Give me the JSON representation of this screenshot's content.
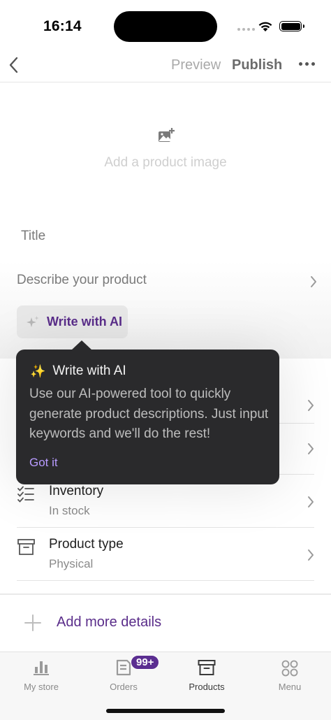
{
  "status_bar": {
    "time": "16:14"
  },
  "nav": {
    "preview_label": "Preview",
    "publish_label": "Publish"
  },
  "image_area": {
    "label": "Add a product image"
  },
  "title_field": {
    "placeholder": "Title"
  },
  "describe": {
    "label": "Describe your product"
  },
  "ai_button": {
    "label": "Write with AI"
  },
  "tooltip": {
    "icon": "✨",
    "title": "Write with AI",
    "body": "Use our AI-powered tool to quickly generate product descriptions. Just input keywords and we'll do the rest!",
    "action": "Got it"
  },
  "rows": [
    {
      "icon": "checklist-icon",
      "title": "Inventory",
      "subtitle": "In stock"
    },
    {
      "icon": "archive-box-icon",
      "title": "Product type",
      "subtitle": "Physical"
    }
  ],
  "add_more": {
    "label": "Add more details"
  },
  "tabs": [
    {
      "icon": "bar-chart-icon",
      "label": "My store"
    },
    {
      "icon": "orders-icon",
      "label": "Orders",
      "badge": "99+"
    },
    {
      "icon": "archive-box-icon",
      "label": "Products"
    },
    {
      "icon": "grid-menu-icon",
      "label": "Menu"
    }
  ],
  "colors": {
    "accent": "#5a2d8a",
    "tooltip_bg": "#2a2a2c",
    "tooltip_action": "#b89bff",
    "badge": "#5b2e91"
  }
}
